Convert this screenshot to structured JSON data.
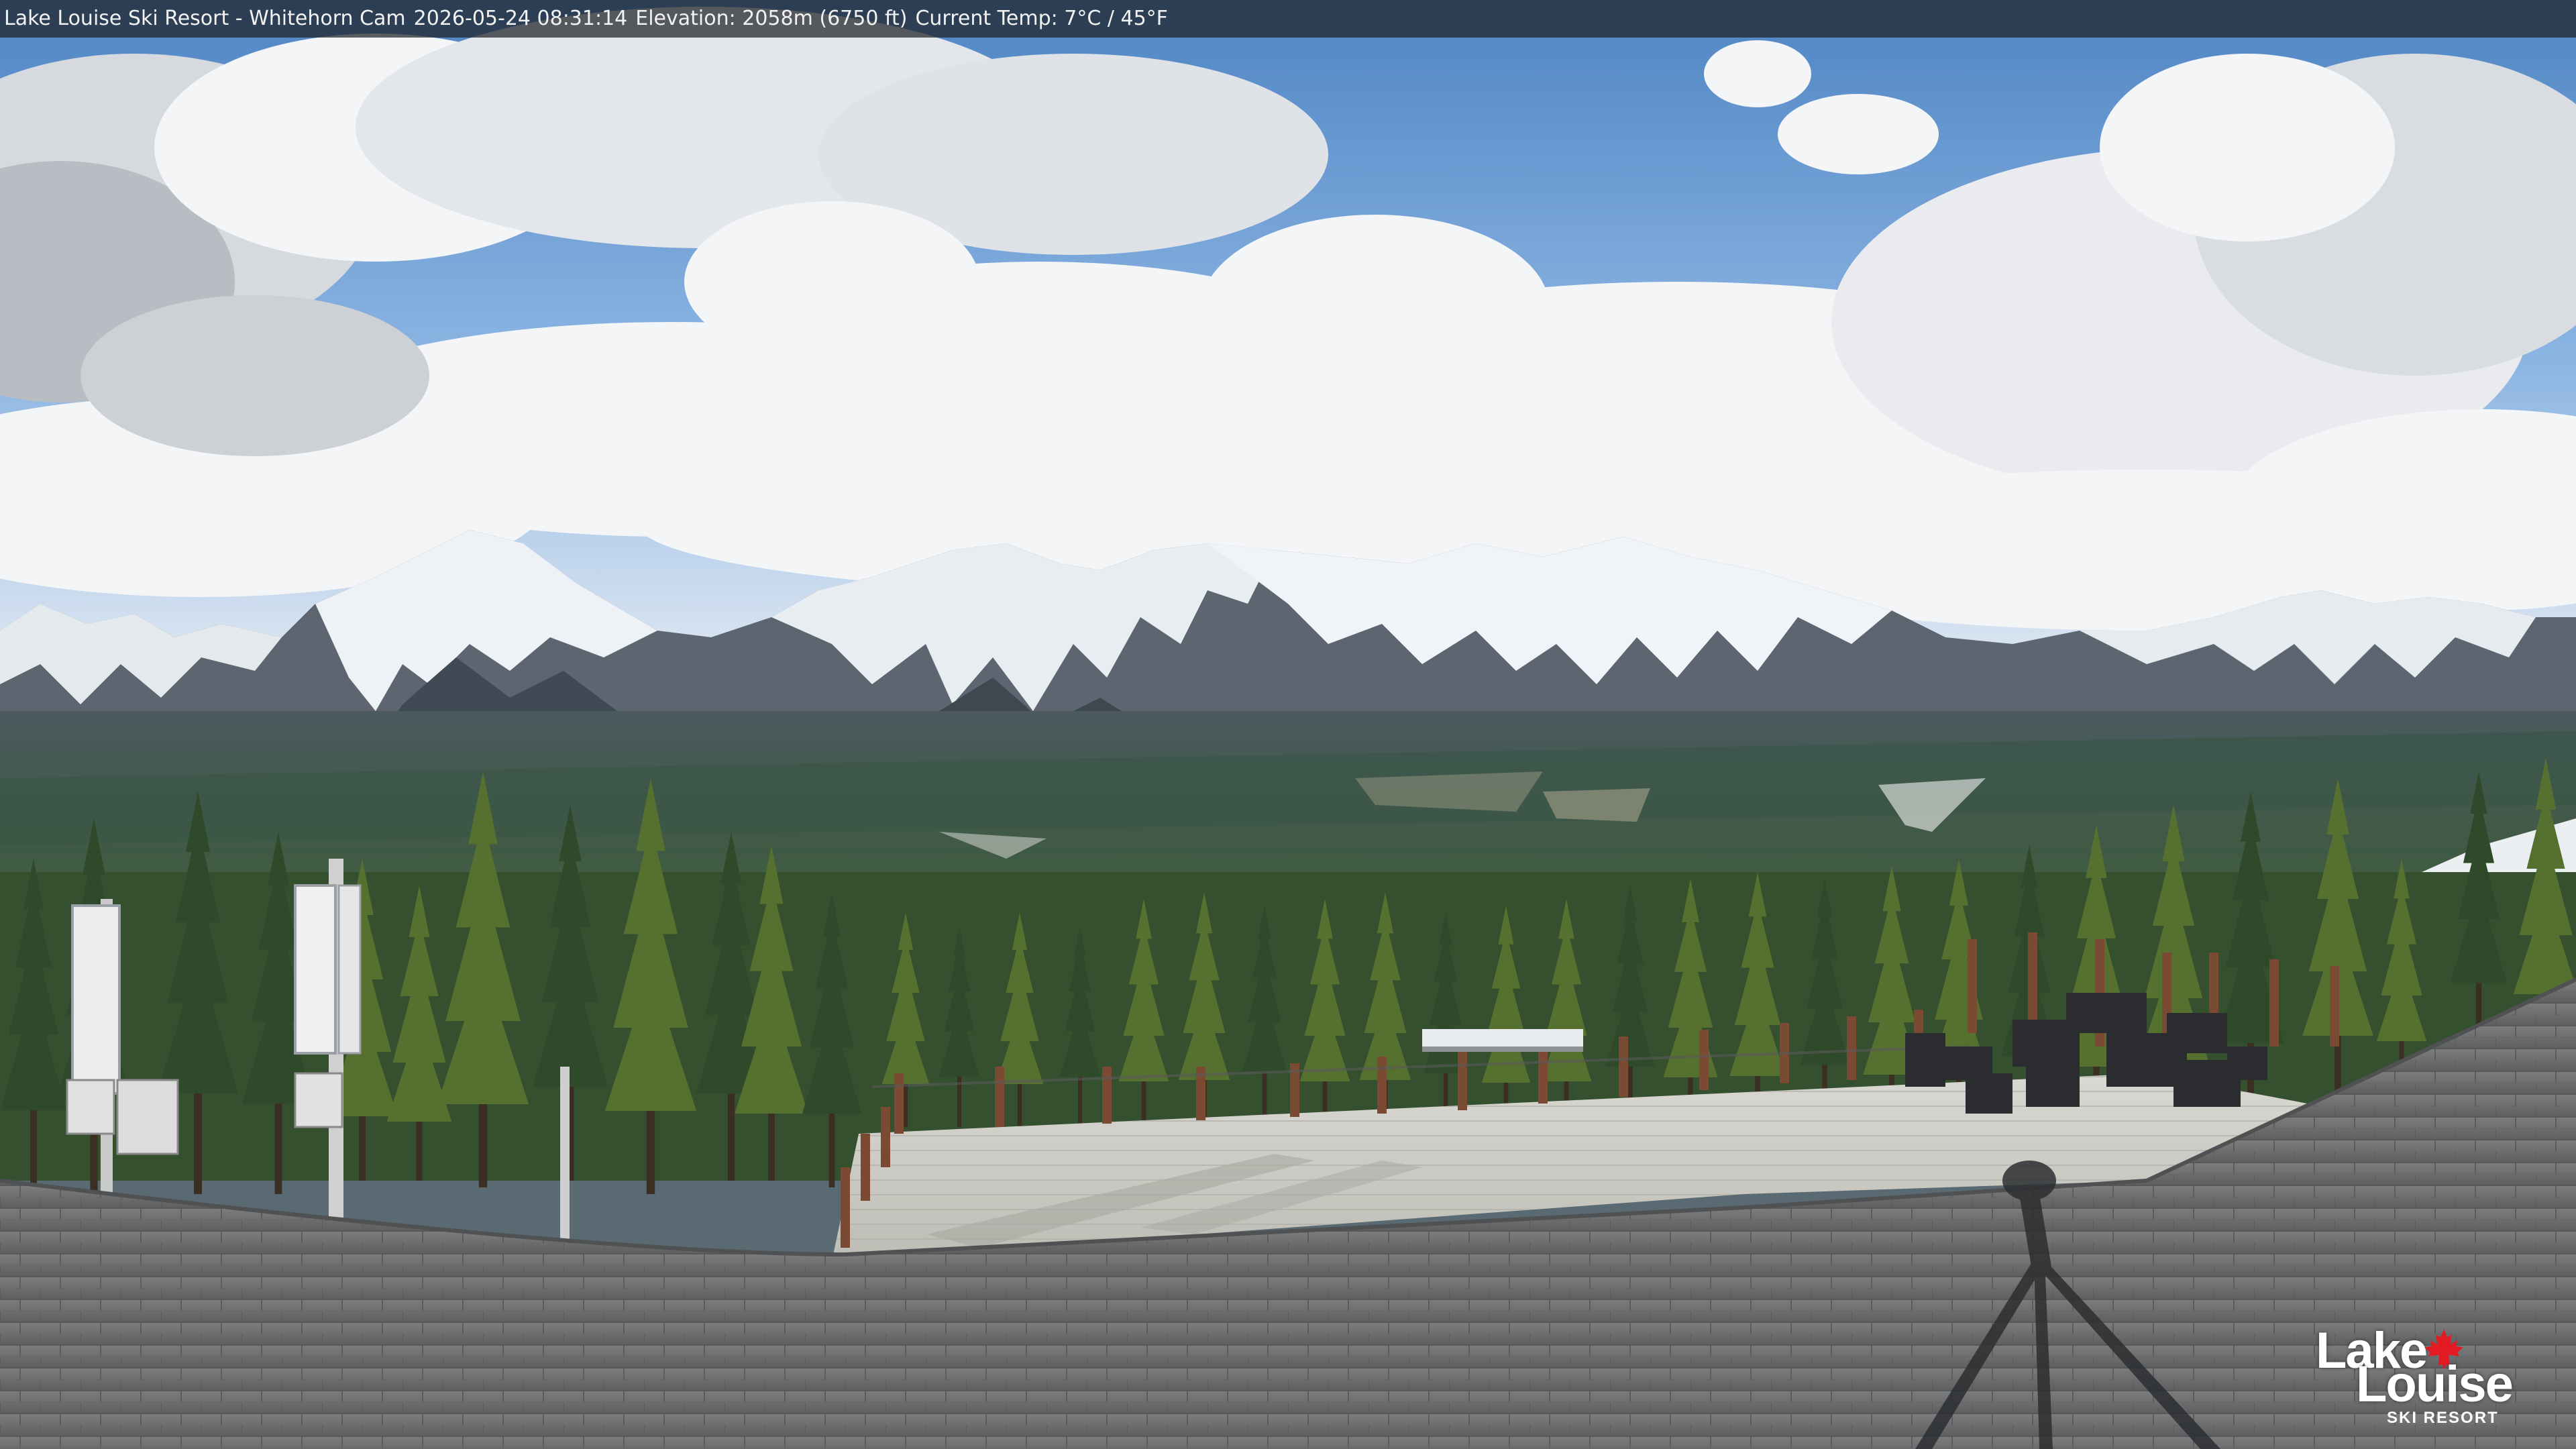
{
  "overlay": {
    "resort": "Lake Louise Ski Resort - Whitehorn Cam",
    "timestamp": "2026-05-24 08:31:14",
    "elevation": "Elevation: 2058m (6750 ft)",
    "temperature": "Current Temp: 7°C / 45°F"
  },
  "logo": {
    "line1": "Lake",
    "line2": "Louise",
    "tagline": "SKI RESORT",
    "leaf_color": "#e21b23"
  },
  "colors": {
    "sky": "#6f9fd6",
    "cloud": "#f3f4f6",
    "snow": "#eef2f6",
    "rock": "#4e5762",
    "valley": "#3d5a44",
    "forest": "#3f5f36",
    "deck": "#cfcfc8",
    "roof": "#6e7072"
  }
}
